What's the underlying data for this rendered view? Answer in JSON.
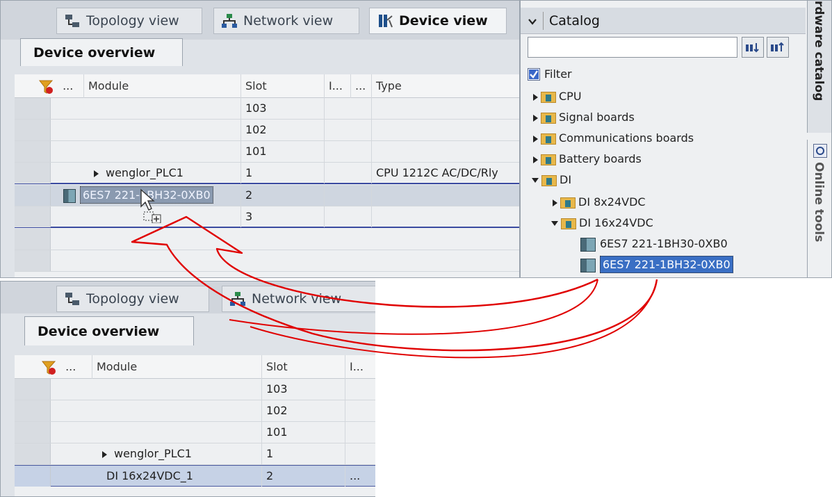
{
  "top_editor": {
    "tabs": {
      "topology": "Topology view",
      "network": "Network view",
      "device": "Device view"
    },
    "subtab": "Device overview",
    "columns": {
      "module": "Module",
      "slot": "Slot",
      "col_i": "I...",
      "col_dots": "...",
      "type": "Type",
      "dots": "..."
    },
    "rows": [
      {
        "module": "",
        "slot": "103",
        "type": ""
      },
      {
        "module": "",
        "slot": "102",
        "type": ""
      },
      {
        "module": "",
        "slot": "101",
        "type": ""
      },
      {
        "module": "wenglor_PLC1",
        "slot": "1",
        "type": "CPU 1212C AC/DC/Rly"
      },
      {
        "module": "6ES7 221-1BH32-0XB0",
        "slot": "2",
        "type": ""
      },
      {
        "module": "",
        "slot": "3",
        "type": ""
      }
    ]
  },
  "bottom_editor": {
    "tabs": {
      "topology": "Topology view",
      "network": "Network view"
    },
    "subtab": "Device overview",
    "columns": {
      "module": "Module",
      "slot": "Slot",
      "col_i": "I...",
      "dots": "..."
    },
    "rows": [
      {
        "module": "",
        "slot": "103"
      },
      {
        "module": "",
        "slot": "102"
      },
      {
        "module": "",
        "slot": "101"
      },
      {
        "module": "wenglor_PLC1",
        "slot": "1"
      },
      {
        "module": "DI 16x24VDC_1",
        "slot": "2",
        "extra": "..."
      }
    ]
  },
  "catalog": {
    "title": "Catalog",
    "search_placeholder": "",
    "filter_label": "Filter",
    "filter_checked": true,
    "items": [
      {
        "label": "CPU",
        "level": 0,
        "expanded": false
      },
      {
        "label": "Signal boards",
        "level": 0,
        "expanded": false
      },
      {
        "label": "Communications boards",
        "level": 0,
        "expanded": false
      },
      {
        "label": "Battery boards",
        "level": 0,
        "expanded": false
      },
      {
        "label": "DI",
        "level": 0,
        "expanded": true
      },
      {
        "label": "DI 8x24VDC",
        "level": 1,
        "expanded": false
      },
      {
        "label": "DI 16x24VDC",
        "level": 1,
        "expanded": true
      },
      {
        "label": "6ES7 221-1BH30-0XB0",
        "level": 2
      },
      {
        "label": "6ES7 221-1BH32-0XB0",
        "level": 2,
        "selected": true
      }
    ],
    "side_tabs": {
      "hardware": "rdware catalog",
      "online": "Online tools"
    }
  },
  "colors": {
    "selection": "#3a6fc4",
    "arrow": "#e00000",
    "row_highlight": "#c6d2e6"
  }
}
